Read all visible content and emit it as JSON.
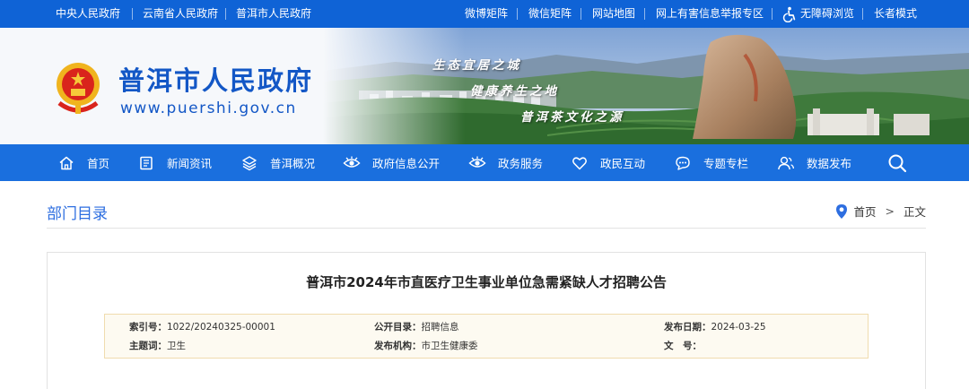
{
  "top_links_left": [
    "中央人民政府",
    "云南省人民政府",
    "普洱市人民政府"
  ],
  "top_links_right": {
    "weibo": "微博矩阵",
    "weixin": "微信矩阵",
    "sitemap": "网站地图",
    "report": "网上有害信息举报专区",
    "accessibility": "无障碍浏览",
    "elder": "长者模式"
  },
  "header": {
    "site_name": "普洱市人民政府",
    "site_url": "www.puershi.gov.cn",
    "slogans": [
      "生态宜居之城",
      "健康养生之地",
      "普洱茶文化之源"
    ]
  },
  "nav": [
    {
      "label": "首页",
      "icon": "home-icon"
    },
    {
      "label": "新闻资讯",
      "icon": "news-icon"
    },
    {
      "label": "普洱概况",
      "icon": "layers-icon"
    },
    {
      "label": "政府信息公开",
      "icon": "eye-icon"
    },
    {
      "label": "政务服务",
      "icon": "eye-icon"
    },
    {
      "label": "政民互动",
      "icon": "heart-icon"
    },
    {
      "label": "专题专栏",
      "icon": "chat-icon"
    },
    {
      "label": "数据发布",
      "icon": "users-icon"
    }
  ],
  "breadcrumb": {
    "section_title": "部门目录",
    "home": "首页",
    "separator": ">",
    "current": "正文"
  },
  "article": {
    "title": "普洱市2024年市直医疗卫生事业单位急需紧缺人才招聘公告",
    "meta": {
      "index_label": "索引号：",
      "index_value": "1022/20240325-00001",
      "catalog_label": "公开目录：",
      "catalog_value": "招聘信息",
      "date_label": "发布日期：",
      "date_value": "2024-03-25",
      "topic_label": "主题词：",
      "topic_value": "卫生",
      "org_label": "发布机构：",
      "org_value": "市卫生健康委",
      "docno_label": "文　号：",
      "docno_value": ""
    }
  },
  "colors": {
    "topbar": "#0f63d6",
    "nav": "#1a6fde",
    "brand_blue": "#1357c6",
    "meta_bg": "#fdfaf1",
    "meta_border": "#f0dcae"
  }
}
